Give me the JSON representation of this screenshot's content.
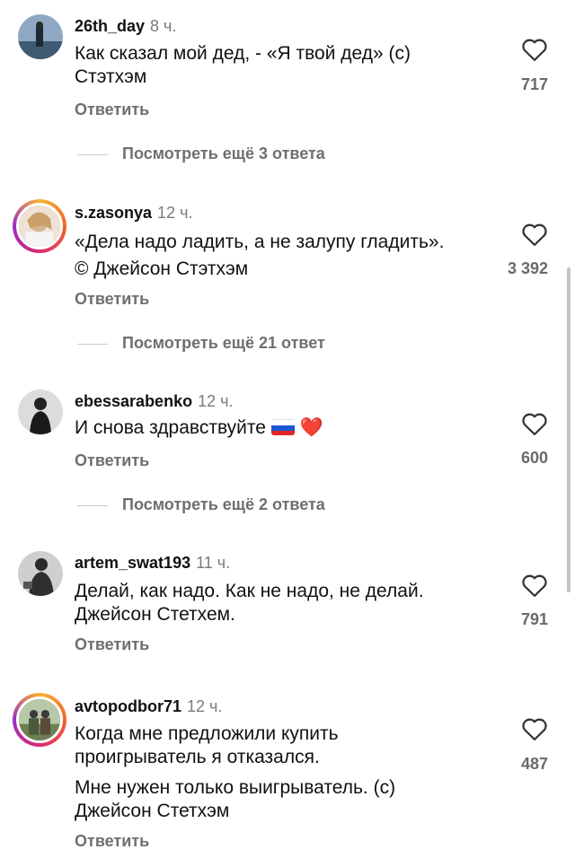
{
  "comments": [
    {
      "username": "26th_day",
      "time": "8 ч.",
      "lines": [
        "Как сказал мой дед, - «Я твой дед» (с)",
        "Стэтхэм"
      ],
      "reply": "Ответить",
      "likes": "717",
      "thread": "Посмотреть ещё 3 ответа"
    },
    {
      "username": "s.zasonya",
      "time": "12 ч.",
      "lines": [
        "«Дела надо ладить, а не залупу гладить».",
        "© Джейсон Стэтхэм"
      ],
      "reply": "Ответить",
      "likes": "3 392",
      "thread": "Посмотреть ещё 21 ответ"
    },
    {
      "username": "ebessarabenko",
      "time": "12 ч.",
      "lines": [
        "И снова здравствуйте"
      ],
      "emoji": "❤️",
      "reply": "Ответить",
      "likes": "600",
      "thread": "Посмотреть ещё 2 ответа"
    },
    {
      "username": "artem_swat193",
      "time": "11 ч.",
      "lines": [
        "Делай, как надо. Как не надо, не делай.",
        "Джейсон Стетхем."
      ],
      "reply": "Ответить",
      "likes": "791"
    },
    {
      "username": "avtopodbor71",
      "time": "12 ч.",
      "lines": [
        "Когда мне предложили купить",
        "проигрыватель я отказался.",
        "Мне нужен только выигрыватель. (с)",
        "Джейсон Стетхэм"
      ],
      "reply": "Ответить",
      "likes": "487"
    }
  ],
  "icons": {
    "like": "heart-icon",
    "flag": "russia-flag-icon"
  },
  "colors": {
    "text": "#111111",
    "muted": "#6f6f6f",
    "divider": "#c9c9c9",
    "story_ring": "#dc2a74"
  }
}
